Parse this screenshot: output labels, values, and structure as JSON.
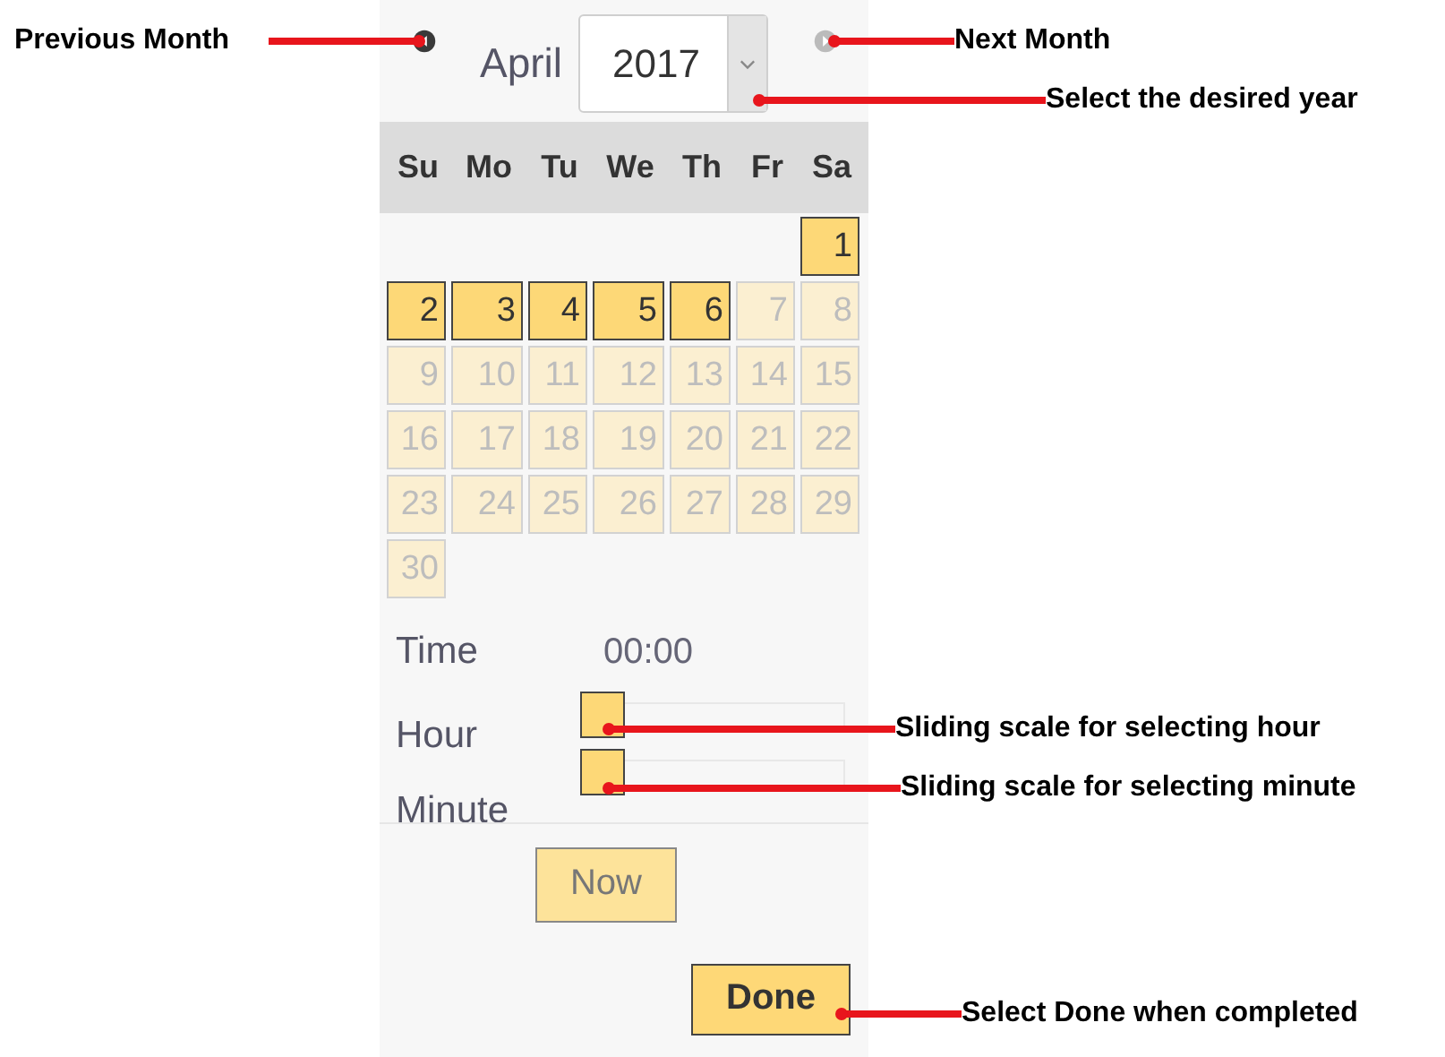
{
  "datepicker": {
    "prev_month": {
      "disabled": false
    },
    "month": "April",
    "year": "2017",
    "next_month": {
      "disabled": true
    },
    "weekdays": [
      "Su",
      "Mo",
      "Tu",
      "We",
      "Th",
      "Fr",
      "Sa"
    ],
    "weeks": [
      {
        "days": [
          {
            "kind": "blank"
          },
          {
            "kind": "blank"
          },
          {
            "kind": "blank"
          },
          {
            "kind": "blank"
          },
          {
            "kind": "blank"
          },
          {
            "kind": "blank"
          },
          {
            "kind": "day",
            "label": "1",
            "disabled": false
          }
        ]
      },
      {
        "days": [
          {
            "kind": "day",
            "label": "2",
            "disabled": false
          },
          {
            "kind": "day",
            "label": "3",
            "disabled": false
          },
          {
            "kind": "day",
            "label": "4",
            "disabled": false
          },
          {
            "kind": "day",
            "label": "5",
            "disabled": false
          },
          {
            "kind": "day",
            "label": "6",
            "disabled": false
          },
          {
            "kind": "day",
            "label": "7",
            "disabled": true
          },
          {
            "kind": "day",
            "label": "8",
            "disabled": true
          }
        ]
      },
      {
        "days": [
          {
            "kind": "day",
            "label": "9",
            "disabled": true
          },
          {
            "kind": "day",
            "label": "10",
            "disabled": true
          },
          {
            "kind": "day",
            "label": "11",
            "disabled": true
          },
          {
            "kind": "day",
            "label": "12",
            "disabled": true
          },
          {
            "kind": "day",
            "label": "13",
            "disabled": true
          },
          {
            "kind": "day",
            "label": "14",
            "disabled": true
          },
          {
            "kind": "day",
            "label": "15",
            "disabled": true
          }
        ]
      },
      {
        "days": [
          {
            "kind": "day",
            "label": "16",
            "disabled": true
          },
          {
            "kind": "day",
            "label": "17",
            "disabled": true
          },
          {
            "kind": "day",
            "label": "18",
            "disabled": true
          },
          {
            "kind": "day",
            "label": "19",
            "disabled": true
          },
          {
            "kind": "day",
            "label": "20",
            "disabled": true
          },
          {
            "kind": "day",
            "label": "21",
            "disabled": true
          },
          {
            "kind": "day",
            "label": "22",
            "disabled": true
          }
        ]
      },
      {
        "days": [
          {
            "kind": "day",
            "label": "23",
            "disabled": true
          },
          {
            "kind": "day",
            "label": "24",
            "disabled": true
          },
          {
            "kind": "day",
            "label": "25",
            "disabled": true
          },
          {
            "kind": "day",
            "label": "26",
            "disabled": true
          },
          {
            "kind": "day",
            "label": "27",
            "disabled": true
          },
          {
            "kind": "day",
            "label": "28",
            "disabled": true
          },
          {
            "kind": "day",
            "label": "29",
            "disabled": true
          }
        ]
      },
      {
        "days": [
          {
            "kind": "day",
            "label": "30",
            "disabled": true
          }
        ]
      }
    ],
    "time_label": "Time",
    "time_value": "00:00",
    "sliders": [
      {
        "label": "Hour",
        "level": 0
      },
      {
        "label": "Minute",
        "level": 0
      }
    ],
    "buttons": [
      {
        "kind": "now",
        "label": "Now"
      },
      {
        "kind": "done",
        "label": "Done"
      }
    ]
  },
  "callouts": [
    "Previous Month",
    "Next Month",
    "Select the desired year",
    "Sliding scale for selecting hour",
    "Sliding scale for selecting minute",
    "Select Done when completed"
  ]
}
